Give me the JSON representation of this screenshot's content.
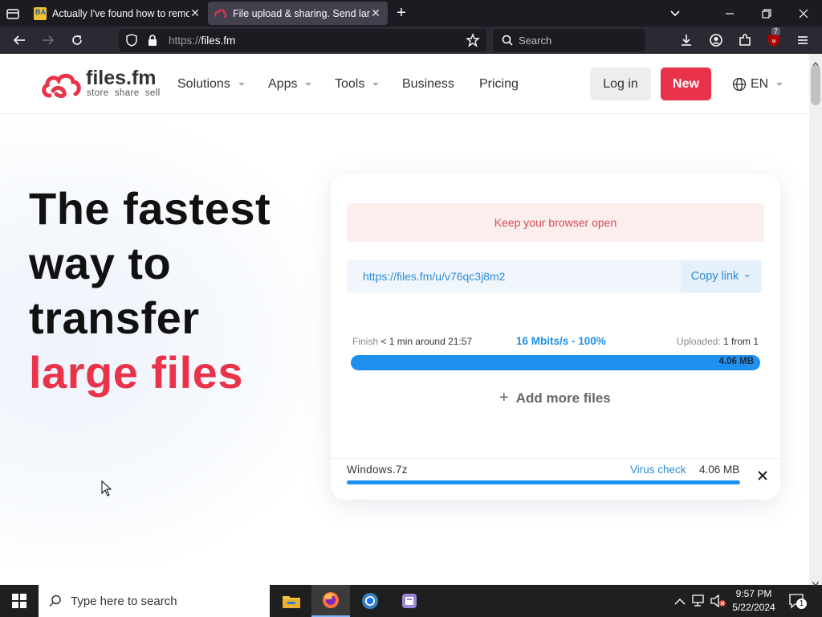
{
  "browser": {
    "tabs": [
      {
        "label": "Actually I've found how to remo",
        "favicon_color": "#f1c232"
      },
      {
        "label": "File upload & sharing. Send larg",
        "favicon_color": "#e8334a",
        "active": true
      }
    ],
    "url_scheme": "https://",
    "url_host": "files.fm",
    "search_placeholder": "Search",
    "extension_badge": "7"
  },
  "site": {
    "logo_name": "files.fm",
    "logo_tagline": "store  share  sell",
    "nav": [
      {
        "label": "Solutions",
        "has_dropdown": true
      },
      {
        "label": "Apps",
        "has_dropdown": true
      },
      {
        "label": "Tools",
        "has_dropdown": true
      },
      {
        "label": "Business",
        "has_dropdown": false
      },
      {
        "label": "Pricing",
        "has_dropdown": false
      }
    ],
    "login_label": "Log in",
    "new_label": "New",
    "lang_label": "EN",
    "brand_color": "#e8334a"
  },
  "hero": {
    "line1": "The fastest",
    "line2": "way to",
    "line3": "transfer",
    "line4": "large files"
  },
  "upload": {
    "notice": "Keep your browser open",
    "link": "https://files.fm/u/v76qc3j8m2",
    "copy_label": "Copy link",
    "finish_label": "Finish",
    "finish_value": "< 1 min around 21:57",
    "speed": "16 Mbits/s - 100%",
    "uploaded_label": "Uploaded:",
    "uploaded_value": "1 from 1",
    "progress_percent": 100,
    "progress_size": "4.06 MB",
    "add_more_label": "Add more files",
    "file": {
      "name": "Windows.7z",
      "virus_check_label": "Virus check",
      "size": "4.06 MB",
      "progress_percent": 100
    }
  },
  "taskbar": {
    "search_placeholder": "Type here to search",
    "time": "9:57 PM",
    "date": "5/22/2024",
    "notification_count": "1"
  }
}
